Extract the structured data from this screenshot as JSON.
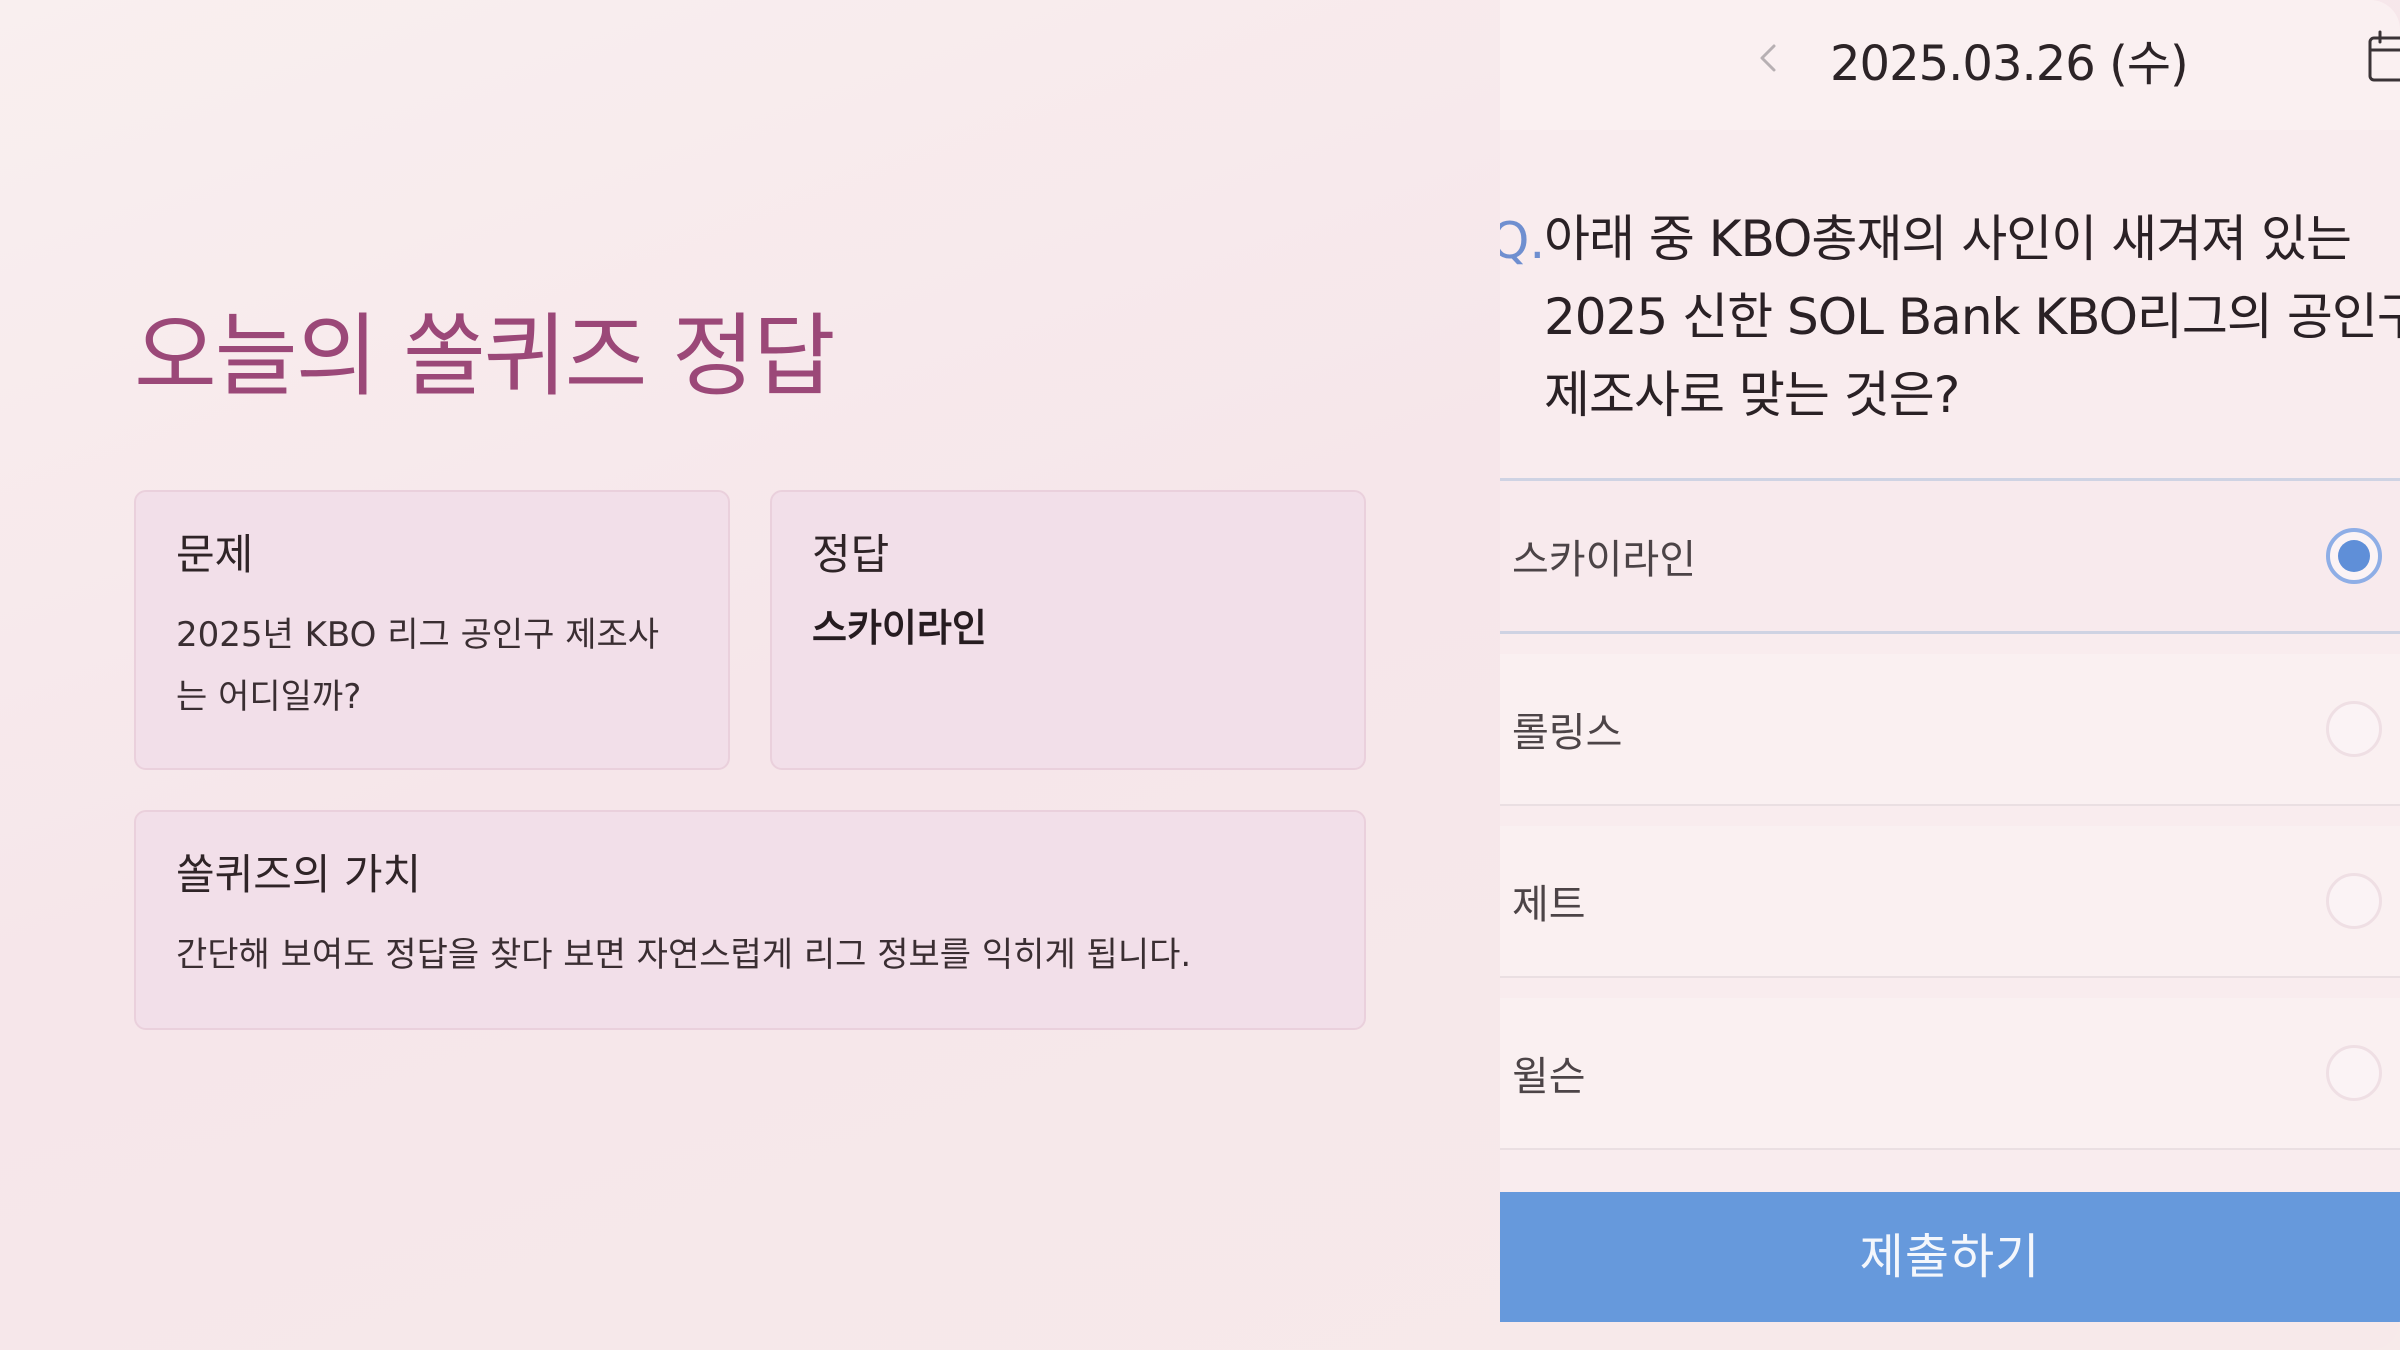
{
  "left": {
    "title": "오늘의 쏠퀴즈 정답",
    "problem_card": {
      "heading": "문제",
      "body": "2025년 KBO 리그 공인구 제조사는 어디일까?"
    },
    "answer_card": {
      "heading": "정답",
      "body": "스카이라인"
    },
    "value_card": {
      "heading": "쏠퀴즈의 가치",
      "body": "간단해 보여도 정답을 찾다 보면 자연스럽게 리그 정보를 익히게 됩니다."
    }
  },
  "right": {
    "date": "2025.03.26 (수)",
    "question_marker": "Q.",
    "question": "아래 중 KBO총재의 사인이 새겨져 있는 2025 신한 SOL Bank KBO리그의 공인구 제조사로 맞는 것은?",
    "options": [
      {
        "label": "스카이라인",
        "selected": true
      },
      {
        "label": "롤링스",
        "selected": false
      },
      {
        "label": "제트",
        "selected": false
      },
      {
        "label": "윌슨",
        "selected": false
      }
    ],
    "submit_label": "제출하기",
    "icons": {
      "prev": "chevron-left-icon",
      "calendar": "calendar-icon"
    },
    "colors": {
      "title": "#9b4878",
      "card_bg": "#f2dfe9",
      "accent_blue": "#6699dc",
      "radio_selected": "#5f8fd8"
    }
  }
}
